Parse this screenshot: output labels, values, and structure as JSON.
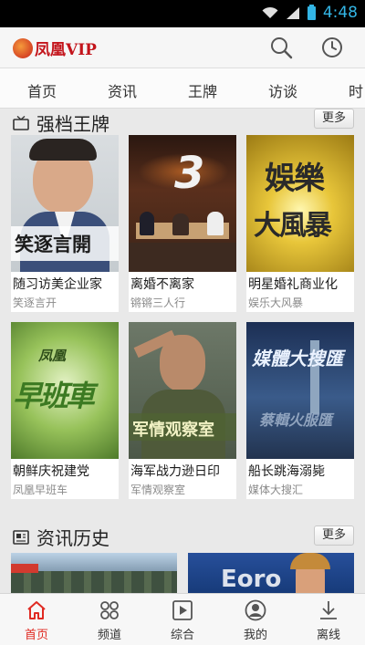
{
  "status_bar": {
    "time": "4:48"
  },
  "header": {
    "logo_text": "凤凰VIP",
    "icons": [
      "search-icon",
      "clock-icon"
    ]
  },
  "tabs": [
    {
      "label": "首页"
    },
    {
      "label": "资讯"
    },
    {
      "label": "王牌"
    },
    {
      "label": "访谈"
    },
    {
      "label": "时"
    }
  ],
  "section_ace": {
    "title": "强档王牌",
    "more_label": "更多",
    "icon": "tv-icon",
    "cards": [
      {
        "title": "随习访美企业家",
        "subtitle": "笑逐言开",
        "thumb_text": "笑逐言開"
      },
      {
        "title": "离婚不离家",
        "subtitle": "锵锵三人行",
        "thumb_text": "3"
      },
      {
        "title": "明星婚礼商业化",
        "subtitle": "娱乐大风暴",
        "thumb_text_1": "娛樂",
        "thumb_text_2": "大風暴"
      },
      {
        "title": "朝鲜庆祝建党",
        "subtitle": "凤凰早班车",
        "thumb_text_1": "凤凰",
        "thumb_text_2": "早班車"
      },
      {
        "title": "海军战力逊日印",
        "subtitle": "军情观察室",
        "thumb_text": "军情观察室"
      },
      {
        "title": "船长跳海溺毙",
        "subtitle": "媒体大搜汇",
        "thumb_text_1": "媒體大搜匯",
        "thumb_text_2": "蔡輯火服匯"
      }
    ]
  },
  "section_history": {
    "title": "资讯历史",
    "more_label": "更多",
    "icon": "newspaper-icon",
    "thumb_text": "Eoro"
  },
  "bottom_nav": [
    {
      "label": "首页",
      "icon": "home-icon",
      "active": true
    },
    {
      "label": "频道",
      "icon": "grid-icon",
      "active": false
    },
    {
      "label": "综合",
      "icon": "play-icon",
      "active": false
    },
    {
      "label": "我的",
      "icon": "user-icon",
      "active": false
    },
    {
      "label": "离线",
      "icon": "download-icon",
      "active": false
    }
  ],
  "colors": {
    "accent": "#e02a22",
    "brand": "#c3141b",
    "status_accent": "#33b5e5"
  }
}
